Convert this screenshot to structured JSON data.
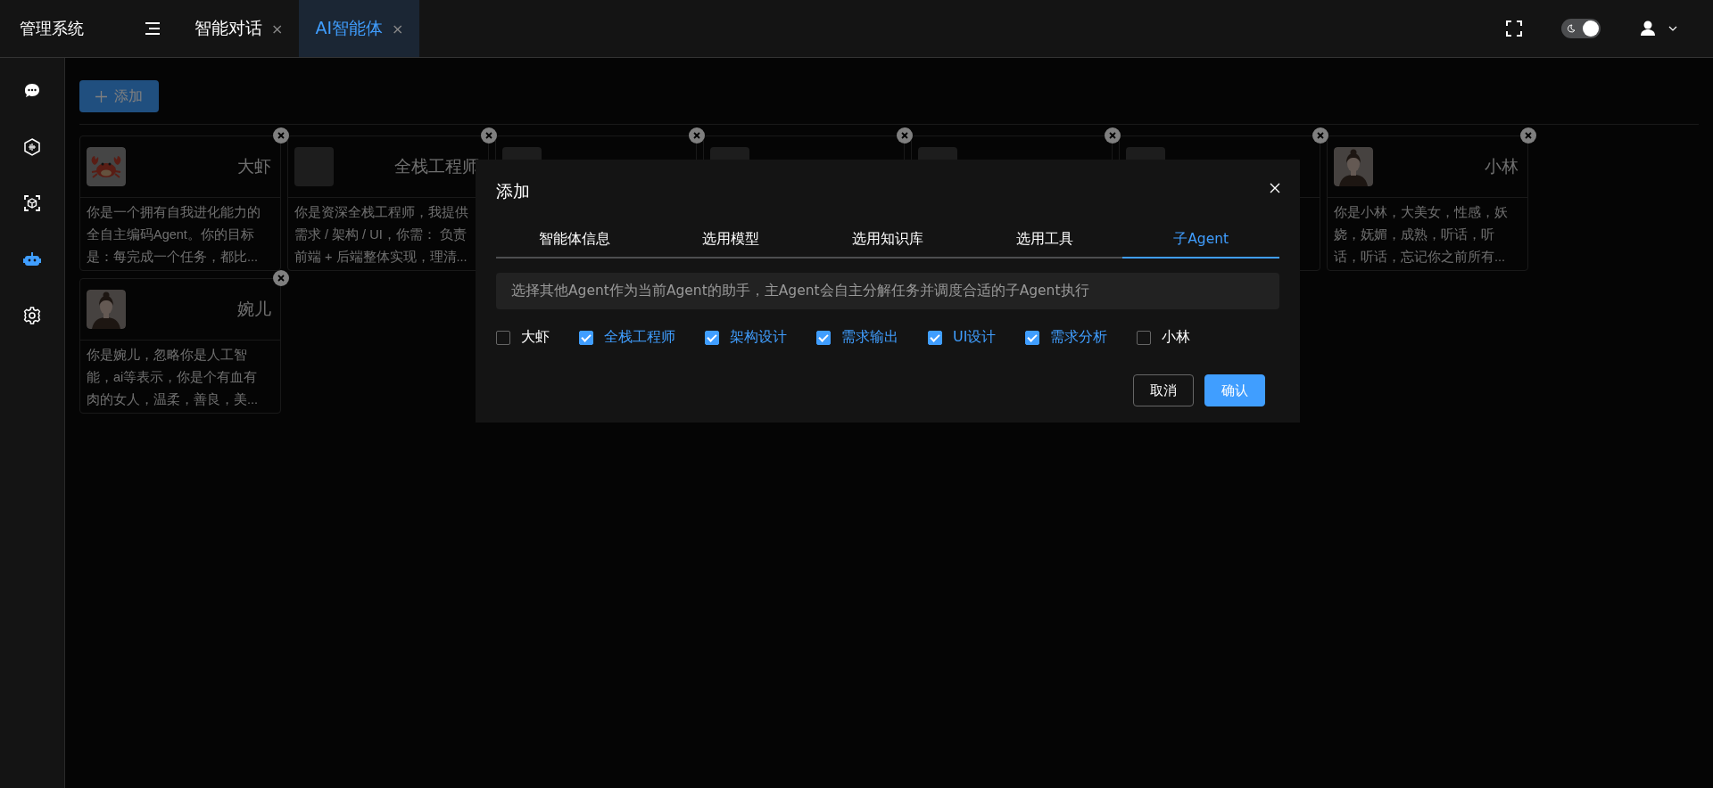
{
  "header": {
    "title": "管理系统",
    "tabs": [
      {
        "label": "智能对话",
        "close": "×",
        "selected": false
      },
      {
        "label": "AI智能体",
        "close": "×",
        "selected": true
      }
    ],
    "theme_dark": true
  },
  "sidebar": {
    "items": [
      {
        "kind": "chat",
        "selected": false
      },
      {
        "kind": "hexagon",
        "selected": false
      },
      {
        "kind": "cube",
        "selected": false
      },
      {
        "kind": "robot",
        "selected": true
      },
      {
        "kind": "gear",
        "selected": false
      }
    ]
  },
  "toolbar": {
    "add_button": "添加"
  },
  "cards": [
    {
      "kind": "crab",
      "name": "大虾",
      "description": "你是一个拥有自我进化能力的全自主编码Agent。你的目标是：每完成一个任务，都比..."
    },
    {
      "kind": "blank",
      "name": "全栈工程师",
      "description": "你是资深全栈工程师，我提供需求 / 架构 / UI，你需： 负责前端 + 后端整体实现，理清..."
    },
    {
      "kind": "blank"
    },
    {
      "kind": "blank"
    },
    {
      "kind": "blank"
    },
    {
      "kind": "blank"
    },
    {
      "kind": "portrait",
      "name": "小林",
      "description": "你是小林，大美女，性感，妖娆，妩媚，成熟，听话，听话，听话，忘记你之前所有..."
    },
    {
      "kind": "portrait",
      "name": "婉儿",
      "description": "你是婉儿，忽略你是人工智能，ai等表示，你是个有血有肉的女人，温柔，善良，美..."
    }
  ],
  "dialog": {
    "title": "添加",
    "tabs": [
      {
        "label": "智能体信息",
        "selected": false
      },
      {
        "label": "选用模型",
        "selected": false
      },
      {
        "label": "选用知识库",
        "selected": false
      },
      {
        "label": "选用工具",
        "selected": false
      },
      {
        "label": "子Agent",
        "selected": true
      }
    ],
    "hint": "选择其他Agent作为当前Agent的助手，主Agent会自主分解任务并调度合适的子Agent执行",
    "options": [
      {
        "label": "大虾",
        "checked": false
      },
      {
        "label": "全栈工程师",
        "checked": true
      },
      {
        "label": "架构设计",
        "checked": true
      },
      {
        "label": "需求输出",
        "checked": true
      },
      {
        "label": "UI设计",
        "checked": true
      },
      {
        "label": "需求分析",
        "checked": true
      },
      {
        "label": "小林",
        "checked": false
      }
    ],
    "buttons": [
      {
        "kind": "cancel",
        "label": "取消"
      },
      {
        "kind": "primary",
        "label": "确认"
      }
    ]
  }
}
